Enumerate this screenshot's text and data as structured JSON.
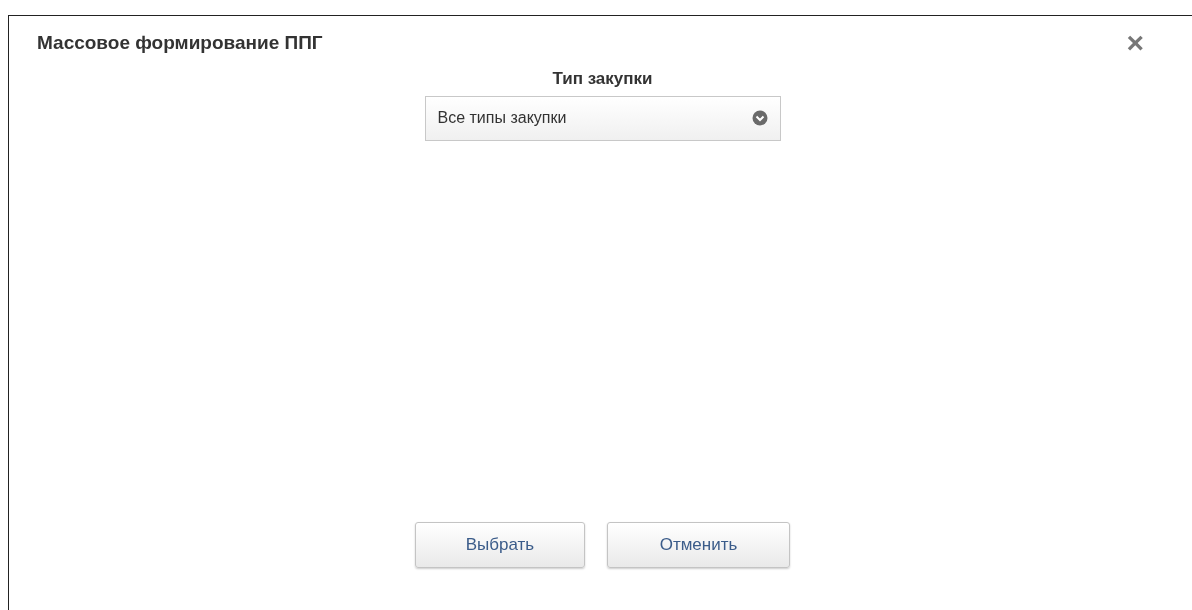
{
  "dialog": {
    "title": "Массовое формирование ППГ",
    "close": "×"
  },
  "field": {
    "label": "Тип закупки",
    "value": "Все типы закупки"
  },
  "buttons": [
    {
      "label": "Выбрать"
    },
    {
      "label": "Отменить"
    }
  ]
}
